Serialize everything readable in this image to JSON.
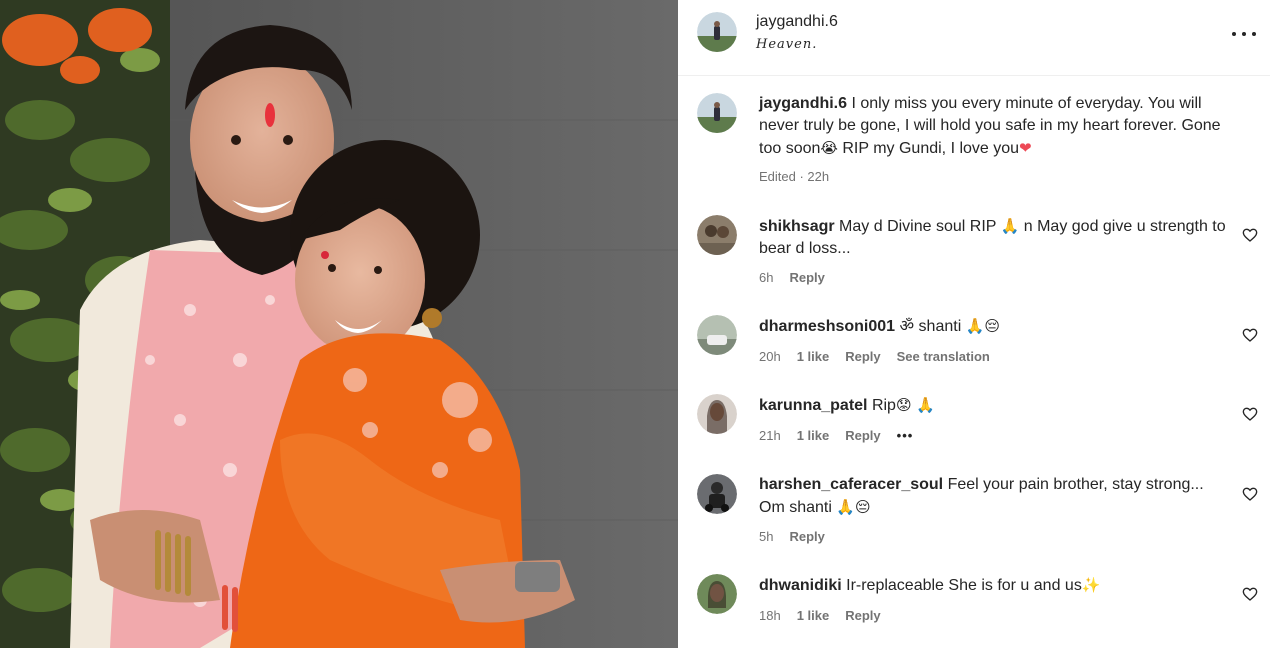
{
  "post": {
    "username": "jaygandhi.6",
    "location": "Heaven.",
    "caption": {
      "username": "jaygandhi.6",
      "text": "I only miss you every minute of everyday. You will never truly be gone, I will hold you safe in my heart forever. Gone too soon",
      "emoji1": "😭",
      "text2": "RIP my Gundi, I love you",
      "emoji2": "❤",
      "meta": "Edited · 22h"
    }
  },
  "comments": [
    {
      "username": "shikhsagr",
      "text": "May d Divine soul RIP",
      "emoji": "🙏",
      "text2": "n May god give u strength to bear d loss...",
      "time": "6h",
      "likes": "",
      "reply": "Reply",
      "extra": ""
    },
    {
      "username": "dharmeshsoni001",
      "text": "ॐ shanti",
      "emoji": "🙏😔",
      "text2": "",
      "time": "20h",
      "likes": "1 like",
      "reply": "Reply",
      "extra": "See translation"
    },
    {
      "username": "karunna_patel",
      "text": "Rip",
      "emoji": "😟 🙏",
      "text2": "",
      "time": "21h",
      "likes": "1 like",
      "reply": "Reply",
      "extra": "•••"
    },
    {
      "username": "harshen_caferacer_soul",
      "text": "Feel your pain brother, stay strong... Om shanti",
      "emoji": "🙏😔",
      "text2": "",
      "time": "5h",
      "likes": "",
      "reply": "Reply",
      "extra": ""
    },
    {
      "username": "dhwanidiki",
      "text": "Ir-replaceable She is for u and us",
      "emoji": "✨",
      "text2": "",
      "time": "18h",
      "likes": "1 like",
      "reply": "Reply",
      "extra": ""
    }
  ],
  "icons": {
    "more": "more-horizontal-icon",
    "like": "heart-outline-icon"
  },
  "colors": {
    "text": "#262626",
    "muted": "#737373",
    "border": "#efefef",
    "heart": "#ed4956"
  }
}
